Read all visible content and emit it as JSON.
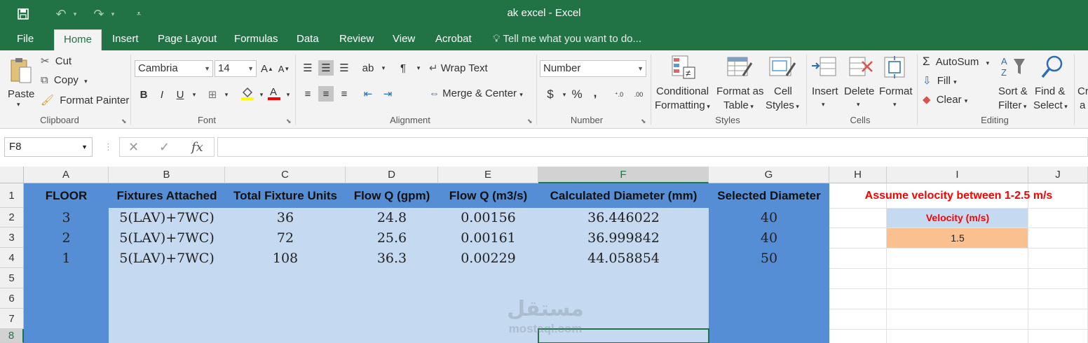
{
  "window": {
    "title": "ak excel - Excel"
  },
  "qat": {
    "save_icon": "save-icon",
    "undo_icon": "undo-icon",
    "redo_icon": "redo-icon"
  },
  "tabs": [
    {
      "label": "File"
    },
    {
      "label": "Home"
    },
    {
      "label": "Insert"
    },
    {
      "label": "Page Layout"
    },
    {
      "label": "Formulas"
    },
    {
      "label": "Data"
    },
    {
      "label": "Review"
    },
    {
      "label": "View"
    },
    {
      "label": "Acrobat"
    }
  ],
  "tell_me": "Tell me what you want to do...",
  "ribbon": {
    "clipboard": {
      "paste": "Paste",
      "cut": "Cut",
      "copy": "Copy",
      "format_painter": "Format Painter",
      "label": "Clipboard"
    },
    "font": {
      "name": "Cambria",
      "size": "14",
      "bold": "B",
      "italic": "I",
      "underline": "U",
      "label": "Font"
    },
    "alignment": {
      "wrap": "Wrap Text",
      "merge": "Merge & Center",
      "label": "Alignment"
    },
    "number": {
      "format": "Number",
      "currency": "$",
      "percent": "%",
      "comma": ",",
      "label": "Number"
    },
    "styles": {
      "conditional_1": "Conditional",
      "conditional_2": "Formatting",
      "format_as_1": "Format as",
      "format_as_2": "Table",
      "cell_styles_1": "Cell",
      "cell_styles_2": "Styles",
      "label": "Styles"
    },
    "cells": {
      "insert": "Insert",
      "delete": "Delete",
      "format": "Format",
      "label": "Cells"
    },
    "editing": {
      "autosum": "AutoSum",
      "fill": "Fill",
      "clear": "Clear",
      "sort_1": "Sort &",
      "sort_2": "Filter",
      "find_1": "Find &",
      "find_2": "Select",
      "more_1": "Cr",
      "more_2": "a",
      "label": "Editing"
    }
  },
  "formula_bar": {
    "name_box": "F8",
    "fx": "fx",
    "formula": ""
  },
  "columns": [
    "A",
    "B",
    "C",
    "D",
    "E",
    "F",
    "G",
    "H",
    "I",
    "J"
  ],
  "rows": [
    "1",
    "2",
    "3",
    "4",
    "5",
    "6",
    "7",
    "8"
  ],
  "selected_cell": "F8",
  "table": {
    "headers": [
      "FLOOR",
      "Fixtures Attached",
      "Total Fixture Units",
      "Flow Q  (gpm)",
      "Flow Q (m3/s)",
      "Calculated Diameter (mm)",
      "Selected Diameter"
    ],
    "rows": [
      [
        "3",
        "5(LAV)+7WC)",
        "36",
        "24.8",
        "0.00156",
        "36.446022",
        "40"
      ],
      [
        "2",
        "5(LAV)+7WC)",
        "72",
        "25.6",
        "0.00161",
        "36.999842",
        "40"
      ],
      [
        "1",
        "5(LAV)+7WC)",
        "108",
        "36.3",
        "0.00229",
        "44.058854",
        "50"
      ]
    ]
  },
  "side_panel": {
    "note": "Assume velocity between 1-2.5 m/s",
    "velocity_label": "Velocity (m/s)",
    "velocity_value": "1.5"
  },
  "watermark": {
    "line1": "مستقل",
    "line2": "mostaql.com"
  },
  "colors": {
    "excel_green": "#217346",
    "header_blue": "#558ed5",
    "light_blue": "#c5d9f1",
    "orange": "#fac090",
    "note_red": "#ff0000"
  }
}
